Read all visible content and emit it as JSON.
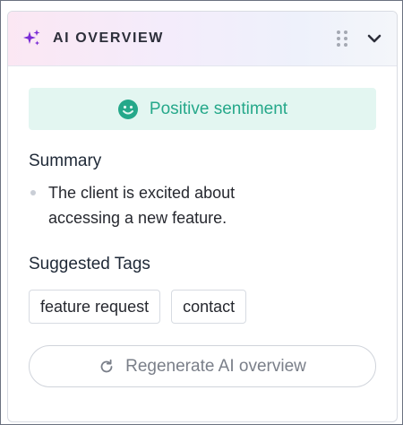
{
  "header": {
    "title": "AI OVERVIEW",
    "icon": "sparkle-icon",
    "drag_icon": "drag-handle-icon",
    "collapse_icon": "chevron-down-icon",
    "accent_color": "#7a2bd6"
  },
  "sentiment": {
    "icon": "smile-icon",
    "label": "Positive sentiment",
    "color": "#25a88a",
    "background": "#e3f6f1"
  },
  "summary": {
    "title": "Summary",
    "items": [
      "The client is excited about accessing a new feature."
    ]
  },
  "tags": {
    "title": "Suggested Tags",
    "items": [
      "feature request",
      "contact"
    ]
  },
  "regenerate": {
    "icon": "refresh-icon",
    "label": "Regenerate AI overview"
  }
}
